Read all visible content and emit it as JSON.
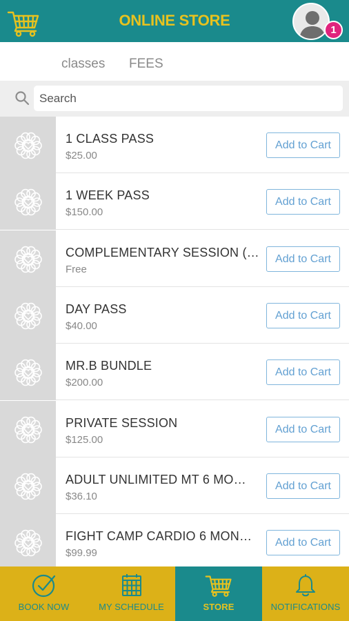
{
  "header": {
    "title": "ONLINE STORE",
    "notification_count": "1"
  },
  "tabs": [
    {
      "label": "classes"
    },
    {
      "label": "FEES"
    }
  ],
  "search": {
    "placeholder": "Search",
    "value": ""
  },
  "products": [
    {
      "name": "1 CLASS PASS",
      "price": "$25.00",
      "button": "Add to Cart"
    },
    {
      "name": "1 WEEK PASS",
      "price": "$150.00",
      "button": "Add to Cart"
    },
    {
      "name": "COMPLEMENTARY SESSION (…",
      "price": "Free",
      "button": "Add to Cart"
    },
    {
      "name": "DAY PASS",
      "price": "$40.00",
      "button": "Add to Cart"
    },
    {
      "name": "MR.B BUNDLE",
      "price": "$200.00",
      "button": "Add to Cart"
    },
    {
      "name": "PRIVATE SESSION",
      "price": "$125.00",
      "button": "Add to Cart"
    },
    {
      "name": "ADULT UNLIMITED MT 6 MO…",
      "price": "$36.10",
      "button": "Add to Cart"
    },
    {
      "name": "FIGHT CAMP CARDIO 6 MON…",
      "price": "$99.99",
      "button": "Add to Cart"
    }
  ],
  "bottom_nav": [
    {
      "label": "BOOK NOW",
      "icon": "check-circle-icon"
    },
    {
      "label": "MY SCHEDULE",
      "icon": "calendar-icon"
    },
    {
      "label": "STORE",
      "icon": "cart-icon",
      "active": true
    },
    {
      "label": "NOTIFICATIONS",
      "icon": "bell-icon"
    }
  ],
  "colors": {
    "header_bg": "#1a8a8c",
    "accent_yellow": "#e7c21f",
    "nav_bg": "#dcb118",
    "badge": "#e0237d",
    "button_text": "#62a0d2"
  }
}
